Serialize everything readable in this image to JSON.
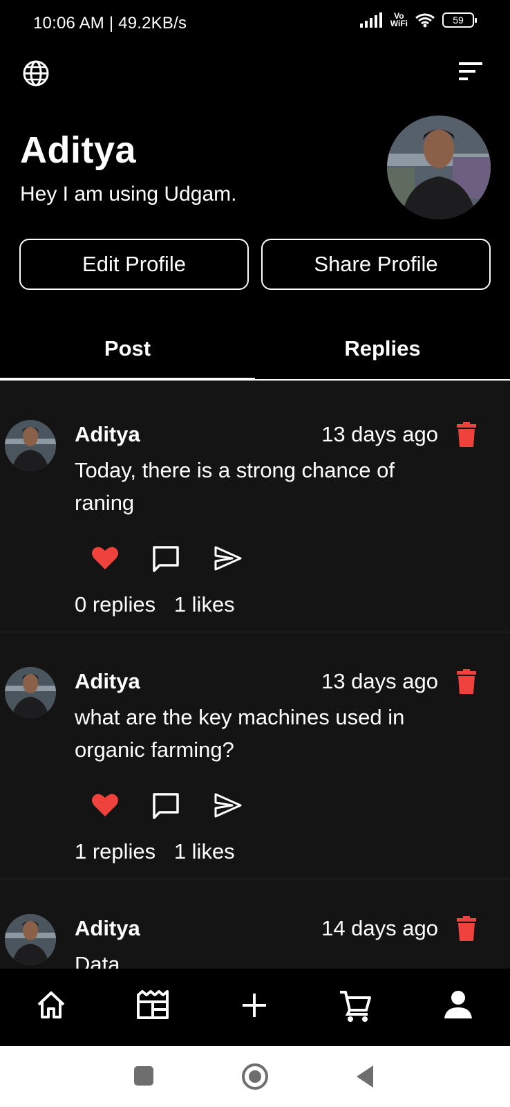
{
  "status_bar": {
    "time": "10:06 AM | 49.2KB/s",
    "network": "Vo WiFi",
    "vowifi_top": "Vo",
    "vowifi_bottom": "WiFi",
    "battery": "59"
  },
  "header": {
    "globe_icon": "globe-icon",
    "menu_icon": "sort-menu-icon"
  },
  "profile": {
    "name": "Aditya",
    "bio": "Hey I am using Udgam.",
    "edit_button": "Edit Profile",
    "share_button": "Share Profile"
  },
  "tabs": [
    {
      "label": "Post",
      "active": true
    },
    {
      "label": "Replies",
      "active": false
    }
  ],
  "posts": [
    {
      "author": "Aditya",
      "time": "13 days ago",
      "text": "Today, there is a strong chance of raning",
      "replies": "0 replies",
      "likes": "1 likes"
    },
    {
      "author": "Aditya",
      "time": "13 days ago",
      "text": "what are the key machines used in organic farming?",
      "replies": "1 replies",
      "likes": "1 likes"
    },
    {
      "author": "Aditya",
      "time": "14 days ago",
      "text": "Data ... "
    }
  ],
  "colors": {
    "accent_red": "#f0423c",
    "background": "#000000",
    "feed_background": "#141414"
  },
  "bottom_nav": [
    "home-icon",
    "feed-icon",
    "add-icon",
    "cart-icon",
    "profile-icon"
  ]
}
